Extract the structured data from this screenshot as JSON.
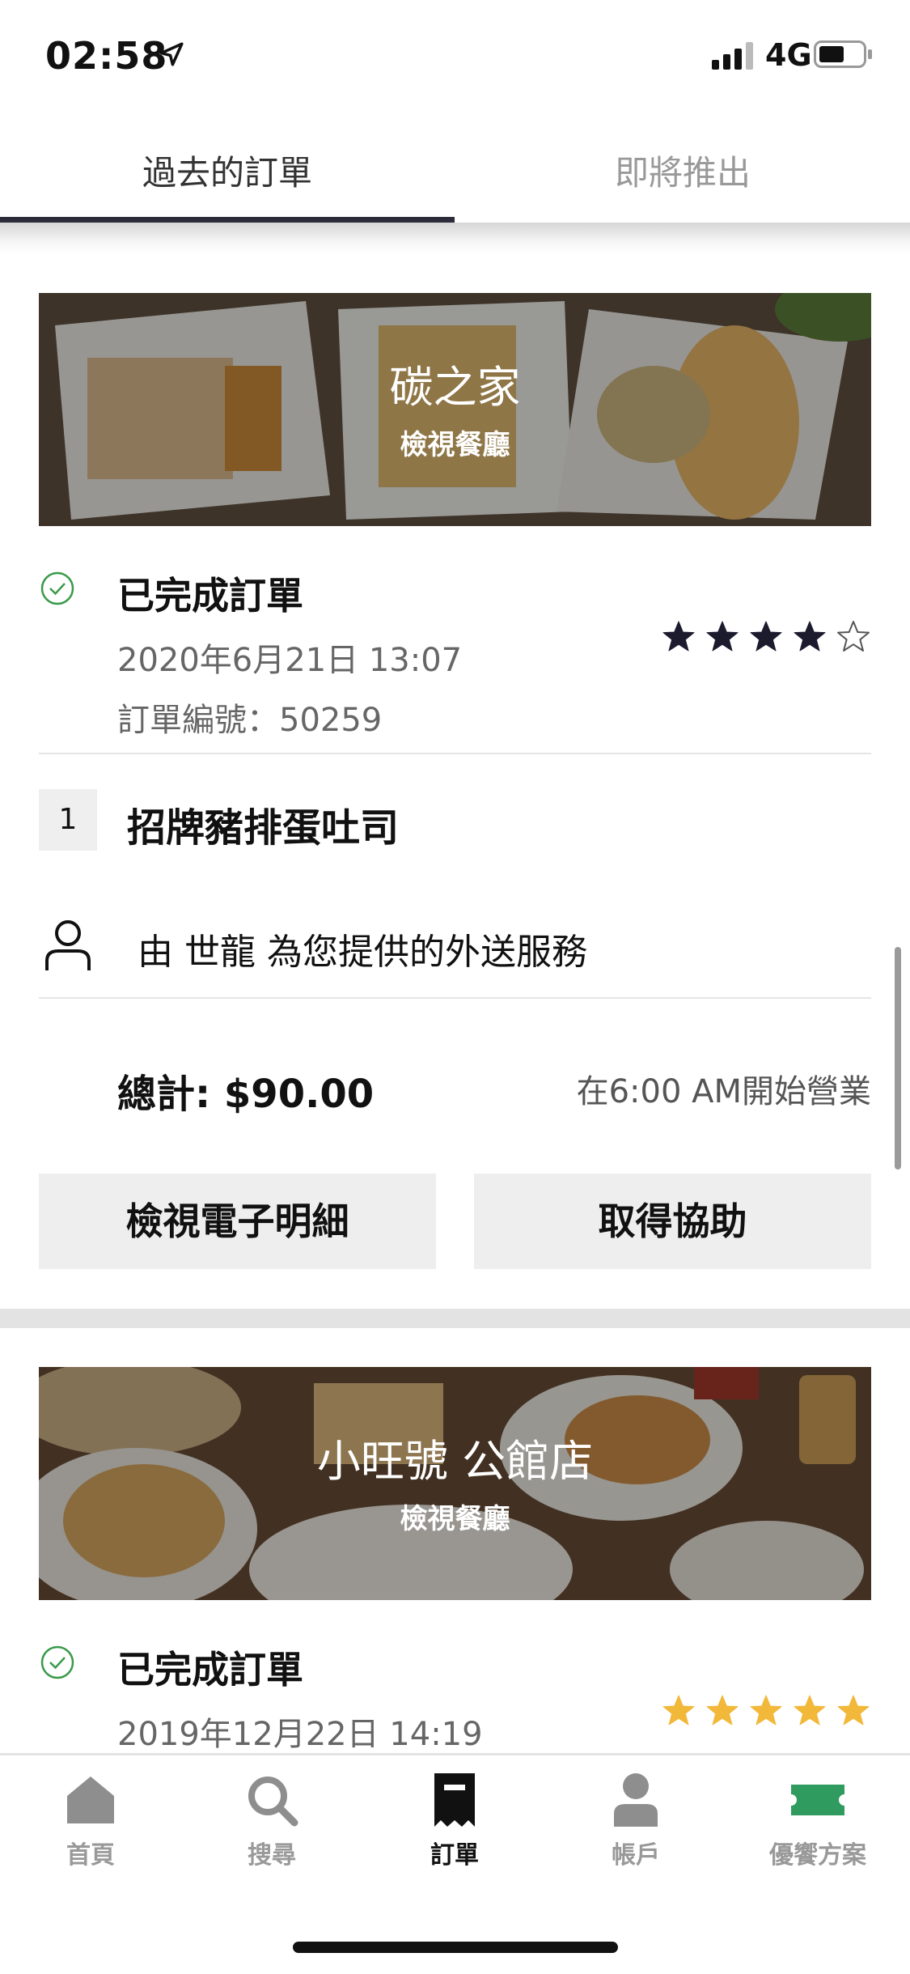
{
  "status_bar": {
    "time": "02:58",
    "network": "4G"
  },
  "tabs": [
    {
      "label": "過去的訂單",
      "active": true
    },
    {
      "label": "即將推出",
      "active": false
    }
  ],
  "orders": [
    {
      "restaurant": "碳之家",
      "view_restaurant": "檢視餐廳",
      "status": "已完成訂單",
      "datetime": "2020年6月21日 13:07",
      "order_no": "訂單編號：50259",
      "rating": 4,
      "item_qty": "1",
      "item_name": "招牌豬排蛋吐司",
      "courier_text": "由 世龍 為您提供的外送服務",
      "total": "總計: $90.00",
      "hours": "在6:00 AM開始營業",
      "btn_receipt": "檢視電子明細",
      "btn_help": "取得協助"
    },
    {
      "restaurant": "小旺號 公館店",
      "view_restaurant": "檢視餐廳",
      "status": "已完成訂單",
      "datetime": "2019年12月22日 14:19",
      "rating": 5
    }
  ],
  "colors": {
    "check": "#3a9a4a",
    "star_dark": "#1c1b2e",
    "star_gold": "#f2b83a",
    "coupon": "#2f9b5e"
  },
  "bottom_nav": [
    {
      "label": "首頁",
      "icon": "home-icon",
      "active": false
    },
    {
      "label": "搜尋",
      "icon": "search-icon",
      "active": false
    },
    {
      "label": "訂單",
      "icon": "receipt-icon",
      "active": true
    },
    {
      "label": "帳戶",
      "icon": "account-icon",
      "active": false
    },
    {
      "label": "優饗方案",
      "icon": "ticket-icon",
      "active": false
    }
  ]
}
